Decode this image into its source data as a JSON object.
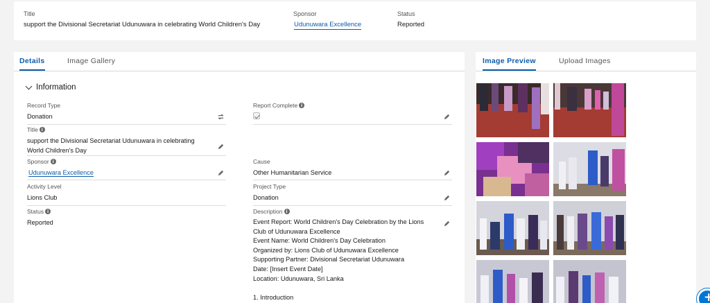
{
  "header": {
    "title_label": "Title",
    "title_value": "support the Divisional Secretariat Udunuwara in celebrating World Children's Day",
    "sponsor_label": "Sponsor",
    "sponsor_value": "Udunuwara Excellence",
    "status_label": "Status",
    "status_value": "Reported"
  },
  "details": {
    "tabs": [
      "Details",
      "Image Gallery"
    ],
    "active_tab": "Details",
    "section_title": "Information",
    "fields": {
      "record_type": {
        "label": "Record Type",
        "value": "Donation"
      },
      "report_complete": {
        "label": "Report Complete",
        "checked": true
      },
      "title": {
        "label": "Title",
        "value": "support the Divisional Secretariat Udunuwara in celebrating World Children's Day"
      },
      "sponsor": {
        "label": "Sponsor",
        "value": "Udunuwara Excellence"
      },
      "cause": {
        "label": "Cause",
        "value": "Other Humanitarian Service"
      },
      "activity_level": {
        "label": "Activity Level",
        "value": "Lions Club"
      },
      "project_type": {
        "label": "Project Type",
        "value": "Donation"
      },
      "status": {
        "label": "Status",
        "value": "Reported"
      },
      "description": {
        "label": "Description",
        "lines": [
          "Event Report: World Children's Day Celebration by the Lions",
          "Club of Udunuwara Excellence",
          "Event Name: World Children's Day Celebration",
          "Organized by: Lions Club of Udunuwara Excellence",
          "Supporting Partner: Divisional Secretariat Udunuwara",
          "Date: [Insert Event Date]",
          "Location: Udunuwara, Sri Lanka",
          "",
          "1. Introduction"
        ]
      }
    }
  },
  "preview": {
    "tabs": [
      "Image Preview",
      "Upload Images"
    ],
    "active_tab": "Image Preview",
    "image_count": 8
  },
  "icons": {
    "edit": "pencil-icon",
    "change_record_type": "swap-icon",
    "info": "info-icon",
    "fab": "plus-icon"
  },
  "colors": {
    "link": "#0b5cab",
    "brand": "#0176d3"
  }
}
